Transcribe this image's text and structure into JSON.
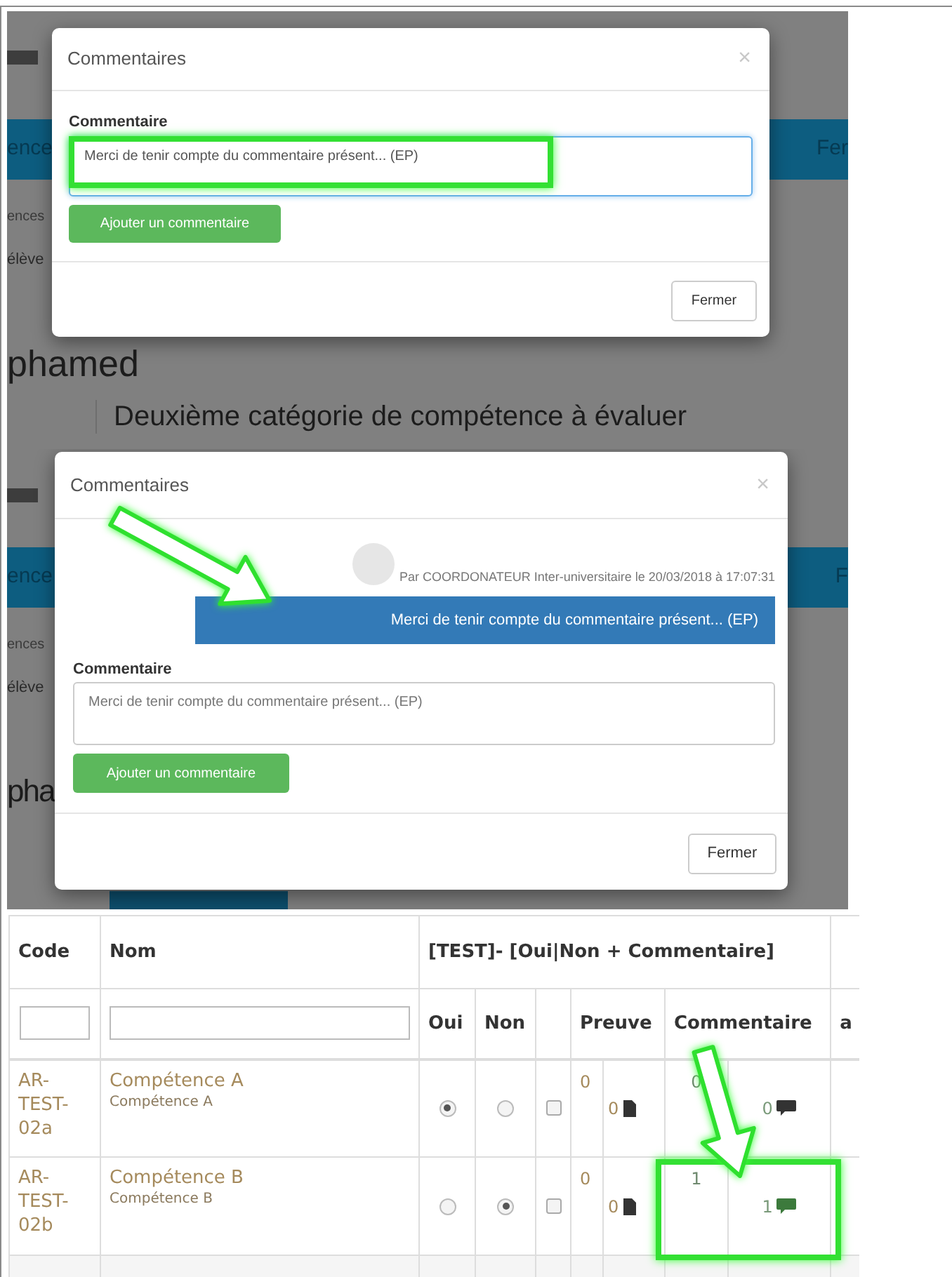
{
  "screenshot_1": {
    "background": {
      "bar_left": "ence",
      "bar_right": "Fer",
      "label": "ences",
      "field": "élève",
      "heading": "phamed",
      "subheading": "Deuxième catégorie de compétence à évaluer"
    },
    "modal": {
      "title": "Commentaires",
      "close": "×",
      "label": "Commentaire",
      "textarea": {
        "value": "Merci de tenir compte du commentaire présent... (EP)",
        "focused": true
      },
      "add_button": "Ajouter un commentaire",
      "close_button": "Fermer"
    }
  },
  "screenshot_2": {
    "background": {
      "bar_left": "ence",
      "bar_right": "F",
      "label": "ences",
      "field": "élève",
      "heading": "pha"
    },
    "modal": {
      "title": "Commentaires",
      "close": "×",
      "messages": [
        {
          "author": "Par COORDONATEUR Inter-universitaire le 20/03/2018 à 17:07:31",
          "text": "Merci de tenir compte du commentaire présent... (EP)"
        }
      ],
      "label": "Commentaire",
      "textarea": {
        "placeholder": "Merci de tenir compte du commentaire présent... (EP)",
        "focused": false
      },
      "add_button": "Ajouter un commentaire",
      "close_button": "Fermer"
    }
  },
  "table": {
    "columns": [
      "Code",
      "Nom"
    ],
    "group_title": "[TEST]- [Oui|Non + Commentaire]",
    "subcolumns": [
      "Oui",
      "Non",
      "Preuve",
      "Commentaire"
    ],
    "column_cut": "a",
    "rows": [
      {
        "code": "AR-TEST-02a",
        "name": "Compétence A",
        "subtitle": "Compétence A",
        "choices": [
          {
            "selected": true
          },
          {
            "selected": false
          }
        ],
        "checked": false,
        "proof_count": "0",
        "proof_files": "0",
        "comment_count": "0",
        "comments": "0",
        "color": "#333333"
      },
      {
        "code": "AR-TEST-02b",
        "name": "Compétence B",
        "subtitle": "Compétence B",
        "choices": [
          {
            "selected": false
          },
          {
            "selected": true
          }
        ],
        "checked": false,
        "proof_count": "0",
        "proof_files": "0",
        "comment_count": "1",
        "comments": "1",
        "color": "#3c7a3c"
      }
    ]
  }
}
